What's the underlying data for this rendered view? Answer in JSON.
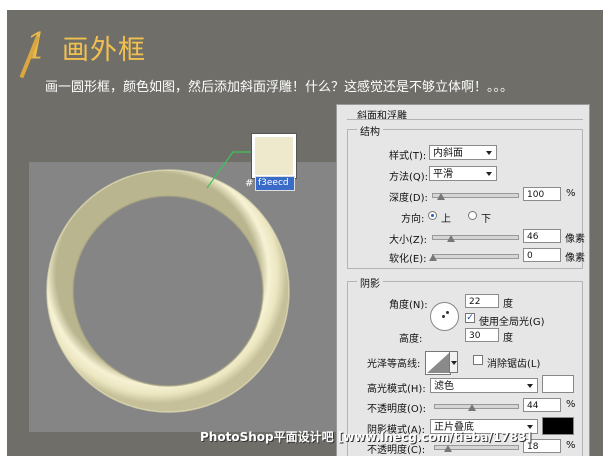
{
  "step": {
    "number": "1",
    "title": "画外框"
  },
  "description": "画一圆形框，颜色如图，然后添加斜面浮雕！什么？这感觉还是不够立体啊！。。。",
  "color_picker": {
    "hash": "#",
    "hex": "f3eecd",
    "swatch_color": "#eee8cc"
  },
  "ring": {
    "fill": "#f0ecc8",
    "shadow": "#b8b48c",
    "canvas_bg": "#858585"
  },
  "dialog": {
    "title": "斜面和浮雕",
    "structure": {
      "title": "结构",
      "style_label": "样式(T):",
      "style_value": "内斜面",
      "technique_label": "方法(Q):",
      "technique_value": "平滑",
      "depth_label": "深度(D):",
      "depth_value": "100",
      "depth_unit": "%",
      "direction_label": "方向:",
      "direction_up": "上",
      "direction_down": "下",
      "size_label": "大小(Z):",
      "size_value": "46",
      "size_unit": "像素",
      "soften_label": "软化(E):",
      "soften_value": "0",
      "soften_unit": "像素"
    },
    "shading": {
      "title": "阴影",
      "angle_label": "角度(N):",
      "angle_value": "22",
      "angle_unit": "度",
      "global_light_label": "使用全局光(G)",
      "altitude_label": "高度:",
      "altitude_value": "30",
      "altitude_unit": "度",
      "gloss_label": "光泽等高线:",
      "antialias_label": "消除锯齿(L)",
      "highlight_mode_label": "高光模式(H):",
      "highlight_mode_value": "滤色",
      "highlight_opacity_label": "不透明度(O):",
      "highlight_opacity_value": "44",
      "highlight_opacity_unit": "%",
      "shadow_mode_label": "阴影模式(A):",
      "shadow_mode_value": "正片叠底",
      "shadow_opacity_label": "不透明度(C):",
      "shadow_opacity_value": "18",
      "shadow_opacity_unit": "%"
    }
  },
  "watermark": "PhotoShop平面设计吧 [www.lnecg.com/tieba/1783]"
}
